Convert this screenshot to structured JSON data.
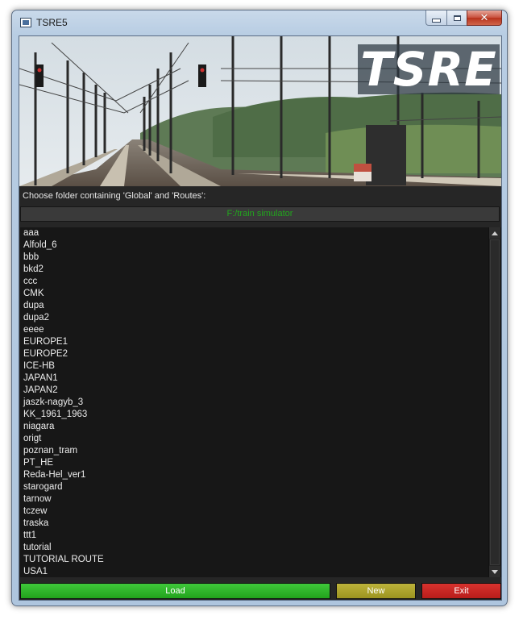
{
  "window": {
    "title": "TSRE5",
    "controls": {
      "minimize_icon": "minimize-icon",
      "maximize_icon": "maximize-icon",
      "close_icon": "close-icon",
      "close_glyph": "✕"
    }
  },
  "banner": {
    "logo_text": "TSRE"
  },
  "folder": {
    "prompt": "Choose folder containing 'Global' and 'Routes':",
    "path": "F:/train simulator",
    "path_color": "#22a61d"
  },
  "routes": [
    "aaa",
    "Alfold_6",
    "bbb",
    "bkd2",
    "ccc",
    "CMK",
    "dupa",
    "dupa2",
    "eeee",
    "EUROPE1",
    "EUROPE2",
    "ICE-HB",
    "JAPAN1",
    "JAPAN2",
    "jaszk-nagyb_3",
    "KK_1961_1963",
    "niagara",
    "origt",
    "poznan_tram",
    "PT_HE",
    "Reda-Hel_ver1",
    "starogard",
    "tarnow",
    "tczew",
    "traska",
    "ttt1",
    "tutorial",
    "TUTORIAL ROUTE",
    "USA1"
  ],
  "buttons": {
    "load": "Load",
    "new": "New",
    "exit": "Exit"
  },
  "colors": {
    "load": "#2bb526",
    "new": "#aea52c",
    "exit": "#c72724",
    "list_bg": "#171717"
  }
}
